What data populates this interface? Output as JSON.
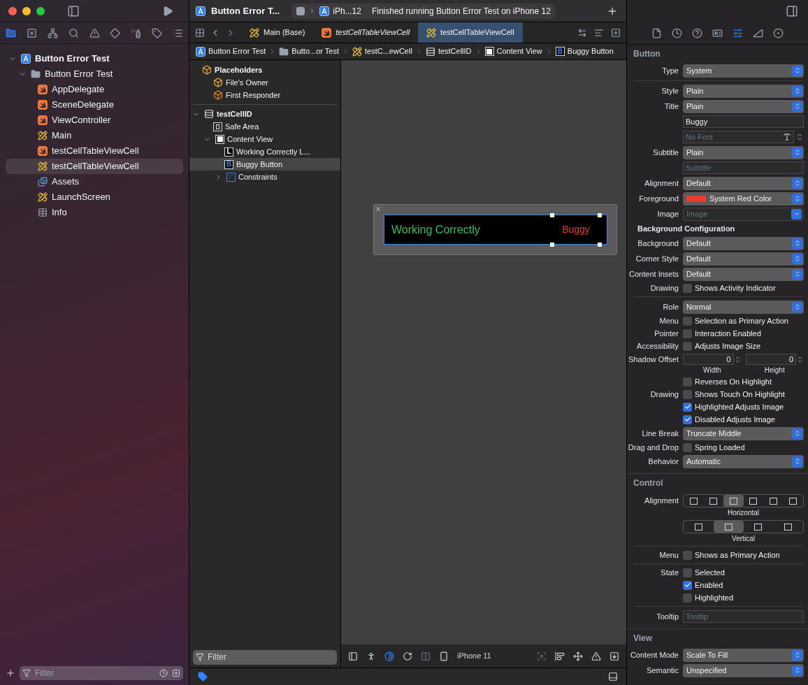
{
  "window": {
    "title": "Button Error T...",
    "scheme": "iPh...12",
    "status": "Finished running Button Error Test on iPhone 12"
  },
  "navigator": {
    "tabs": [
      {
        "selected": true
      },
      {
        "selected": false
      },
      {
        "selected": false
      },
      {
        "selected": false
      },
      {
        "selected": false
      },
      {
        "selected": false
      },
      {
        "selected": false
      },
      {
        "selected": false
      },
      {
        "selected": false
      }
    ],
    "tree": [
      {
        "label": "Button Error Test",
        "kind": "project",
        "expanded": true,
        "selected": false,
        "children": [
          {
            "label": "Button Error Test",
            "kind": "folder",
            "expanded": true,
            "selected": false,
            "children": [
              {
                "label": "AppDelegate",
                "kind": "swift",
                "selected": false
              },
              {
                "label": "SceneDelegate",
                "kind": "swift",
                "selected": false
              },
              {
                "label": "ViewController",
                "kind": "swift",
                "selected": false
              },
              {
                "label": "Main",
                "kind": "xib",
                "selected": false
              },
              {
                "label": "testCellTableViewCell",
                "kind": "swift",
                "selected": false
              },
              {
                "label": "testCellTableViewCell",
                "kind": "xib",
                "selected": true
              },
              {
                "label": "Assets",
                "kind": "assets",
                "selected": false
              },
              {
                "label": "LaunchScreen",
                "kind": "xib",
                "selected": false
              },
              {
                "label": "Info",
                "kind": "plist",
                "selected": false
              }
            ]
          }
        ]
      }
    ],
    "filter": {
      "placeholder": "Filter"
    }
  },
  "editor": {
    "tabs": [
      {
        "label": "Main (Base)",
        "kind": "xib",
        "selected": false,
        "preview": false
      },
      {
        "label": "testCellTableViewCell",
        "kind": "swift",
        "selected": false,
        "preview": true
      },
      {
        "label": "testCellTableViewCell",
        "kind": "xib",
        "selected": true,
        "preview": false
      }
    ],
    "breadcrumb": [
      {
        "label": "Button Error Test",
        "kind": "project"
      },
      {
        "label": "Butto...or Test",
        "kind": "folder"
      },
      {
        "label": "testC...ewCell",
        "kind": "xib"
      },
      {
        "label": "testCellID",
        "kind": "cell"
      },
      {
        "label": "Content View",
        "kind": "view"
      },
      {
        "label": "Buggy Button",
        "kind": "button",
        "badge": "B"
      }
    ],
    "outline": [
      {
        "label": "Placeholders",
        "kind": "placeholders",
        "selected": false,
        "children": [
          {
            "label": "File's Owner",
            "kind": "owner",
            "selected": false
          },
          {
            "label": "First Responder",
            "kind": "responder",
            "selected": false
          }
        ]
      },
      {
        "label": "testCellID",
        "kind": "cell",
        "expanded": true,
        "selected": false,
        "children": [
          {
            "label": "Safe Area",
            "kind": "safearea",
            "selected": false
          },
          {
            "label": "Content View",
            "kind": "view",
            "expanded": true,
            "selected": false,
            "children": [
              {
                "label": "Working Correctly L...",
                "kind": "label",
                "badge": "L",
                "selected": false
              },
              {
                "label": "Buggy Button",
                "kind": "button",
                "badge": "B",
                "selected": true
              },
              {
                "label": "Constraints",
                "kind": "constraints",
                "expanded": false,
                "selected": false
              }
            ]
          }
        ]
      }
    ],
    "outline_filter": {
      "placeholder": "Filter"
    },
    "canvas": {
      "label_text": "Working Correctly",
      "button_title": "Buggy"
    },
    "device": "iPhone 11"
  },
  "inspector": {
    "tabs": [
      {
        "selected": false
      },
      {
        "selected": false
      },
      {
        "selected": false
      },
      {
        "selected": false
      },
      {
        "selected": true
      },
      {
        "selected": false
      },
      {
        "selected": false
      }
    ],
    "sections": [
      {
        "title": "Button",
        "rows": [
          {
            "kind": "popup",
            "label": "Type",
            "value": "System"
          },
          {
            "kind": "divider"
          },
          {
            "kind": "popup",
            "label": "Style",
            "value": "Plain"
          },
          {
            "kind": "popup",
            "label": "Title",
            "value": "Plain"
          },
          {
            "kind": "field",
            "value": "Buggy"
          },
          {
            "kind": "font",
            "placeholder": "No Font"
          },
          {
            "kind": "popup",
            "label": "Subtitle",
            "value": "Plain"
          },
          {
            "kind": "field",
            "placeholder": "Subtitle"
          },
          {
            "kind": "popup",
            "label": "Alignment",
            "value": "Default"
          },
          {
            "kind": "color",
            "label": "Foreground",
            "value": "System Red Color",
            "color": "#eb3a30"
          },
          {
            "kind": "combo",
            "label": "Image",
            "placeholder": "Image"
          },
          {
            "kind": "heading",
            "text": "Background Configuration"
          },
          {
            "kind": "popup",
            "label": "Background",
            "value": "Default"
          },
          {
            "kind": "popup",
            "label": "Corner Style",
            "value": "Default"
          },
          {
            "kind": "popup",
            "label": "Content Insets",
            "value": "Default"
          },
          {
            "kind": "check",
            "label": "Drawing",
            "text": "Shows Activity Indicator",
            "checked": false
          },
          {
            "kind": "divider"
          },
          {
            "kind": "popup",
            "label": "Role",
            "value": "Normal"
          },
          {
            "kind": "check",
            "label": "Menu",
            "text": "Selection as Primary Action",
            "checked": false
          },
          {
            "kind": "check",
            "label": "Pointer",
            "text": "Interaction Enabled",
            "checked": false
          },
          {
            "kind": "check",
            "label": "Accessibility",
            "text": "Adjusts Image Size",
            "checked": false
          },
          {
            "kind": "steppers",
            "label": "Shadow Offset",
            "fields": [
              {
                "value": "0",
                "caption": "Width"
              },
              {
                "value": "0",
                "caption": "Height"
              }
            ]
          },
          {
            "kind": "check",
            "text": "Reverses On Highlight",
            "checked": false
          },
          {
            "kind": "check",
            "label": "Drawing",
            "text": "Shows Touch On Highlight",
            "checked": false
          },
          {
            "kind": "check",
            "text": "Highlighted Adjusts Image",
            "checked": true
          },
          {
            "kind": "check",
            "text": "Disabled Adjusts Image",
            "checked": true
          },
          {
            "kind": "popup",
            "label": "Line Break",
            "value": "Truncate Middle"
          },
          {
            "kind": "check",
            "label": "Drag and Drop",
            "text": "Spring Loaded",
            "checked": false
          },
          {
            "kind": "popup",
            "label": "Behavior",
            "value": "Automatic"
          }
        ]
      },
      {
        "title": "Control",
        "rows": [
          {
            "kind": "segments",
            "label": "Alignment",
            "caption": "Horizontal",
            "segments": [
              {
                "selected": false
              },
              {
                "selected": false
              },
              {
                "selected": true
              },
              {
                "selected": false
              },
              {
                "selected": false
              },
              {
                "selected": false
              }
            ]
          },
          {
            "kind": "segments",
            "caption": "Vertical",
            "segments": [
              {
                "selected": false
              },
              {
                "selected": true
              },
              {
                "selected": false
              },
              {
                "selected": false
              }
            ]
          },
          {
            "kind": "divider"
          },
          {
            "kind": "check",
            "label": "Menu",
            "text": "Shows as Primary Action",
            "checked": false
          },
          {
            "kind": "divider"
          },
          {
            "kind": "check",
            "label": "State",
            "text": "Selected",
            "checked": false
          },
          {
            "kind": "check",
            "text": "Enabled",
            "checked": true
          },
          {
            "kind": "check",
            "text": "Highlighted",
            "checked": false
          },
          {
            "kind": "divider"
          },
          {
            "kind": "field",
            "label": "Tooltip",
            "placeholder": "Tooltip"
          }
        ]
      },
      {
        "title": "View",
        "rows": [
          {
            "kind": "popup",
            "label": "Content Mode",
            "value": "Scale To Fill"
          },
          {
            "kind": "popup",
            "label": "Semantic",
            "value": "Unspecified"
          }
        ]
      }
    ]
  }
}
